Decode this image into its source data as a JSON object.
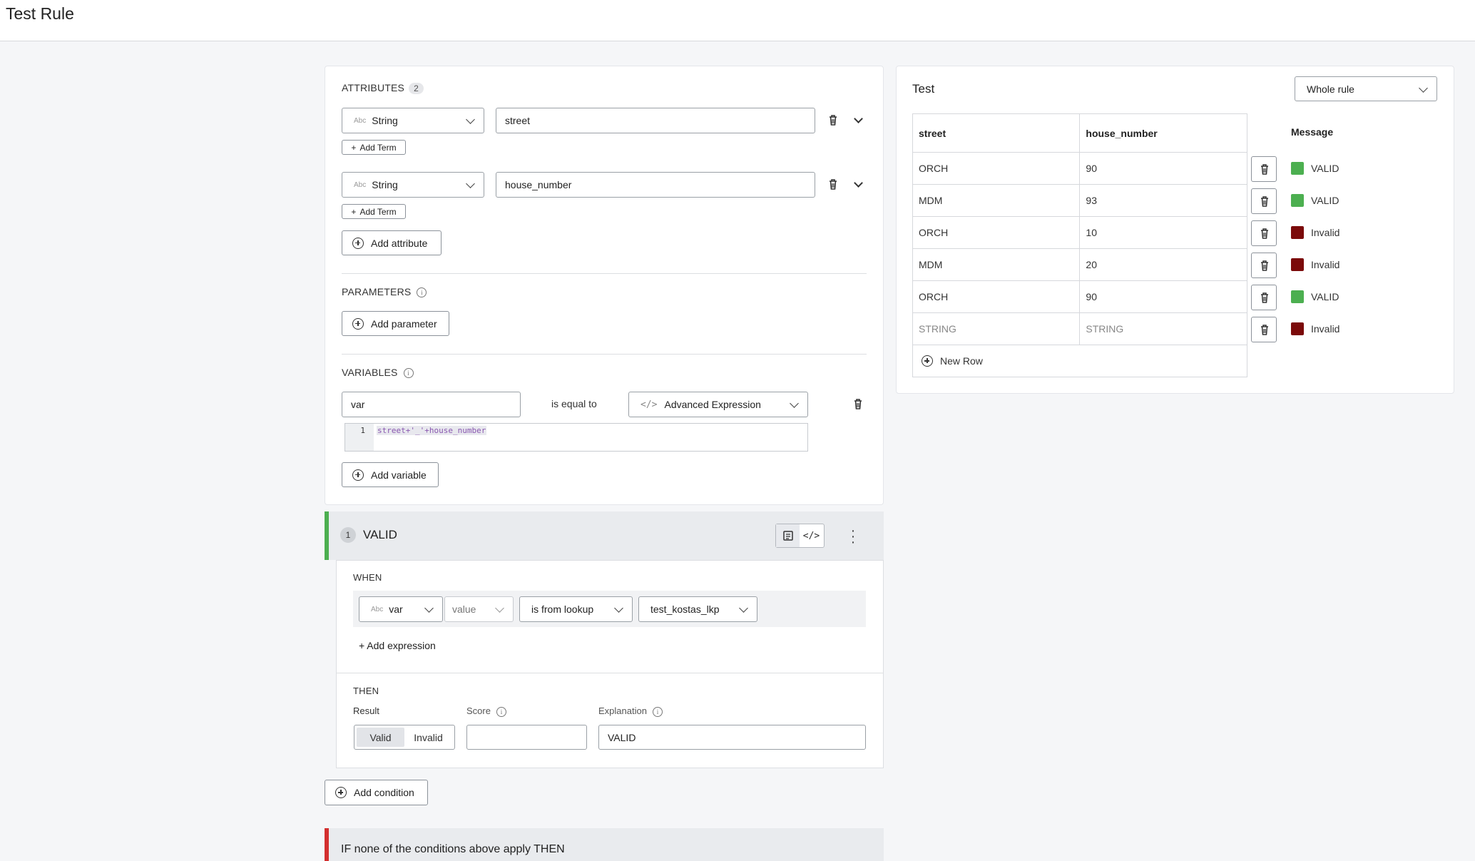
{
  "header": {
    "title": "Test Rule"
  },
  "attributes": {
    "label": "ATTRIBUTES",
    "count": "2",
    "items": [
      {
        "type_abbr": "Abc",
        "type": "String",
        "name": "street",
        "add_term": "Add Term"
      },
      {
        "type_abbr": "Abc",
        "type": "String",
        "name": "house_number",
        "add_term": "Add Term"
      }
    ],
    "add_button": "Add attribute"
  },
  "parameters": {
    "label": "PARAMETERS",
    "add_button": "Add parameter"
  },
  "variables": {
    "label": "VARIABLES",
    "name": "var",
    "operator": "is equal to",
    "expression_type": "Advanced Expression",
    "code_line_number": "1",
    "code": "street+'_'+house_number",
    "add_button": "Add variable"
  },
  "condition": {
    "index": "1",
    "title": "VALID",
    "accent_color": "#4caf50",
    "when_label": "WHEN",
    "field_abbr": "Abc",
    "field": "var",
    "property": "value",
    "operator": "is from lookup",
    "lookup": "test_kostas_lkp",
    "add_expression": "+ Add expression",
    "then_label": "THEN",
    "result_label": "Result",
    "score_label": "Score",
    "explanation_label": "Explanation",
    "result_options": [
      "Valid",
      "Invalid"
    ],
    "selected_result": "Valid",
    "score_value": "",
    "explanation_value": "VALID"
  },
  "add_condition": "Add condition",
  "fallback": {
    "title": "IF none of the conditions above apply THEN",
    "accent_color": "#d32f2f"
  },
  "test_panel": {
    "title": "Test",
    "scope": "Whole rule",
    "columns": [
      "street",
      "house_number"
    ],
    "message_header": "Message",
    "rows": [
      {
        "street": "ORCH",
        "house_number": "90",
        "message": "VALID",
        "status_color": "#4caf50"
      },
      {
        "street": "MDM",
        "house_number": "93",
        "message": "VALID",
        "status_color": "#4caf50"
      },
      {
        "street": "ORCH",
        "house_number": "10",
        "message": "Invalid",
        "status_color": "#7b0a0a"
      },
      {
        "street": "MDM",
        "house_number": "20",
        "message": "Invalid",
        "status_color": "#7b0a0a"
      },
      {
        "street": "ORCH",
        "house_number": "90",
        "message": "VALID",
        "status_color": "#4caf50"
      },
      {
        "street": "STRING",
        "house_number": "STRING",
        "message": "Invalid",
        "status_color": "#7b0a0a"
      }
    ],
    "new_row": "New Row"
  }
}
